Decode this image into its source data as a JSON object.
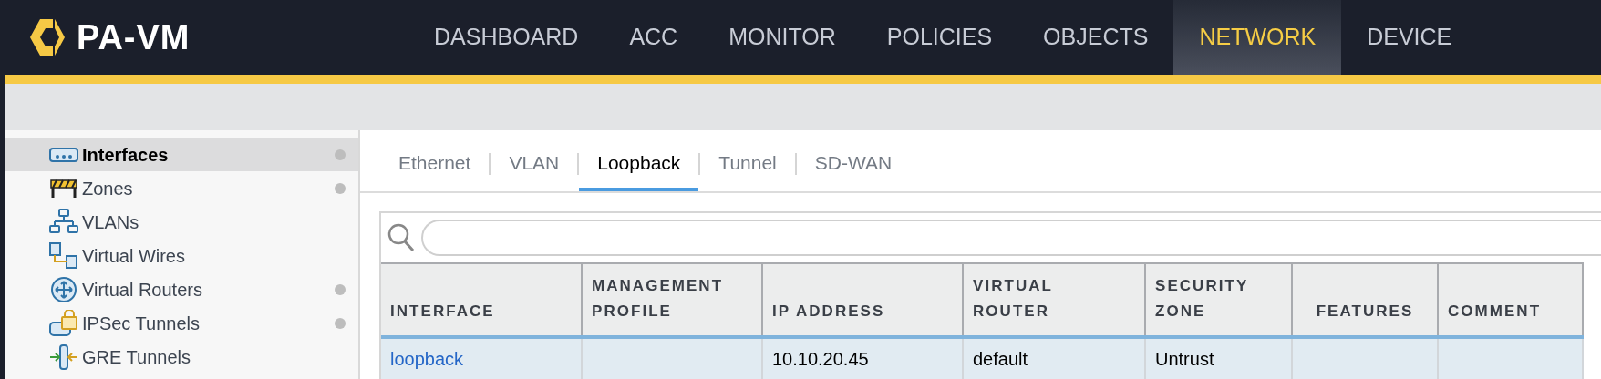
{
  "header": {
    "logo_text": "PA-VM",
    "nav": [
      {
        "label": "DASHBOARD",
        "selected": false
      },
      {
        "label": "ACC",
        "selected": false
      },
      {
        "label": "MONITOR",
        "selected": false
      },
      {
        "label": "POLICIES",
        "selected": false
      },
      {
        "label": "OBJECTS",
        "selected": false
      },
      {
        "label": "NETWORK",
        "selected": true
      },
      {
        "label": "DEVICE",
        "selected": false
      }
    ]
  },
  "sidebar": {
    "items": [
      {
        "label": "Interfaces",
        "kind": "interfaces",
        "selected": true,
        "dot": true
      },
      {
        "label": "Zones",
        "kind": "zones",
        "selected": false,
        "dot": true
      },
      {
        "label": "VLANs",
        "kind": "vlans",
        "selected": false,
        "dot": false
      },
      {
        "label": "Virtual Wires",
        "kind": "wires",
        "selected": false,
        "dot": false
      },
      {
        "label": "Virtual Routers",
        "kind": "routers",
        "selected": false,
        "dot": true
      },
      {
        "label": "IPSec Tunnels",
        "kind": "ipsec",
        "selected": false,
        "dot": true
      },
      {
        "label": "GRE Tunnels",
        "kind": "gre",
        "selected": false,
        "dot": false
      }
    ]
  },
  "tabs": [
    {
      "label": "Ethernet",
      "selected": false
    },
    {
      "label": "VLAN",
      "selected": false
    },
    {
      "label": "Loopback",
      "selected": true
    },
    {
      "label": "Tunnel",
      "selected": false
    },
    {
      "label": "SD-WAN",
      "selected": false
    }
  ],
  "table": {
    "columns": [
      "INTERFACE",
      "MANAGEMENT PROFILE",
      "IP ADDRESS",
      "VIRTUAL ROUTER",
      "SECURITY ZONE",
      "FEATURES",
      "COMMENT"
    ],
    "rows": [
      {
        "selected": true,
        "cells": [
          "loopback",
          "",
          "10.10.20.45",
          "default",
          "Untrust",
          "",
          ""
        ]
      }
    ]
  }
}
